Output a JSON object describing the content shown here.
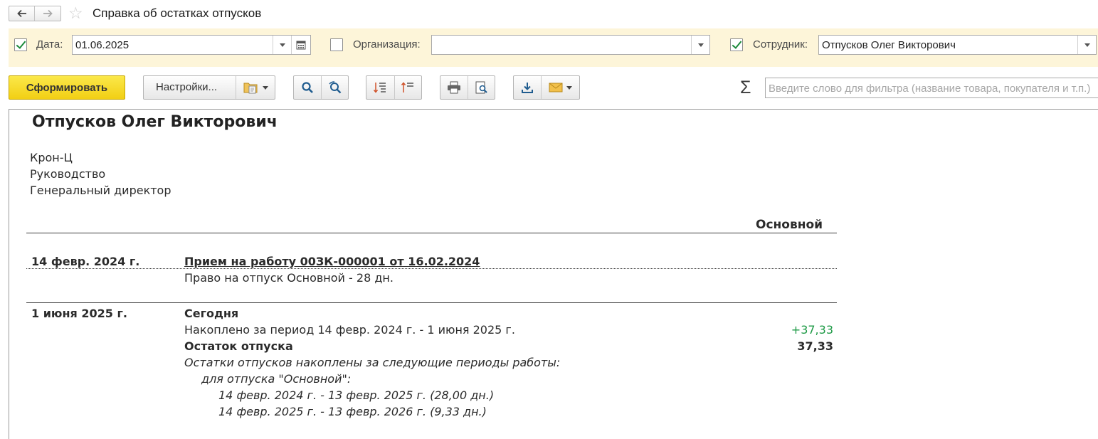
{
  "window": {
    "title": "Справка об остатках отпусков",
    "nav_back_icon": "arrow-left-icon",
    "nav_forward_icon": "arrow-right-icon",
    "favorite_icon": "star-icon"
  },
  "filters": {
    "date": {
      "checked": true,
      "label": "Дата:",
      "value": "01.06.2025"
    },
    "organization": {
      "checked": false,
      "label": "Организация:",
      "value": ""
    },
    "employee": {
      "checked": true,
      "label": "Сотрудник:",
      "value": "Отпусков Олег Викторович"
    }
  },
  "toolbar": {
    "generate_label": "Сформировать",
    "settings_label": "Настройки...",
    "search_placeholder": "Введите слово для фильтра (название товара, покупателя и т.п.)",
    "sum_symbol": "Σ"
  },
  "report": {
    "employee_name": "Отпусков Олег Викторович",
    "organization": "Крон-Ц",
    "department": "Руководство",
    "position": "Генеральный директор",
    "column_header": "Основной",
    "rows": [
      {
        "date": "14 февр. 2024 г.",
        "document_link": "Прием на работу 00ЗК-000001 от 16.02.2024",
        "details": "Право на отпуск Основной - 28 дн."
      },
      {
        "date": "1 июня 2025 г.",
        "title": "Сегодня",
        "accrued_label": "Накоплено за период 14 февр. 2024 г. - 1 июня 2025 г.",
        "accrued_value": "+37,33",
        "balance_label": "Остаток отпуска",
        "balance_value": "37,33",
        "periods_heading": "Остатки отпусков накоплены за следующие периоды работы:",
        "periods_subheading": "для отпуска \"Основной\":",
        "periods": [
          "14 февр. 2024 г. - 13 февр. 2025 г. (28,00 дн.)",
          "14 февр. 2025 г. - 13 февр. 2026 г. (9,33 дн.)"
        ]
      }
    ]
  },
  "colors": {
    "accent_yellow": "#f5d51e",
    "filter_bg": "#fdf5d9",
    "positive_green": "#1e9a46"
  }
}
